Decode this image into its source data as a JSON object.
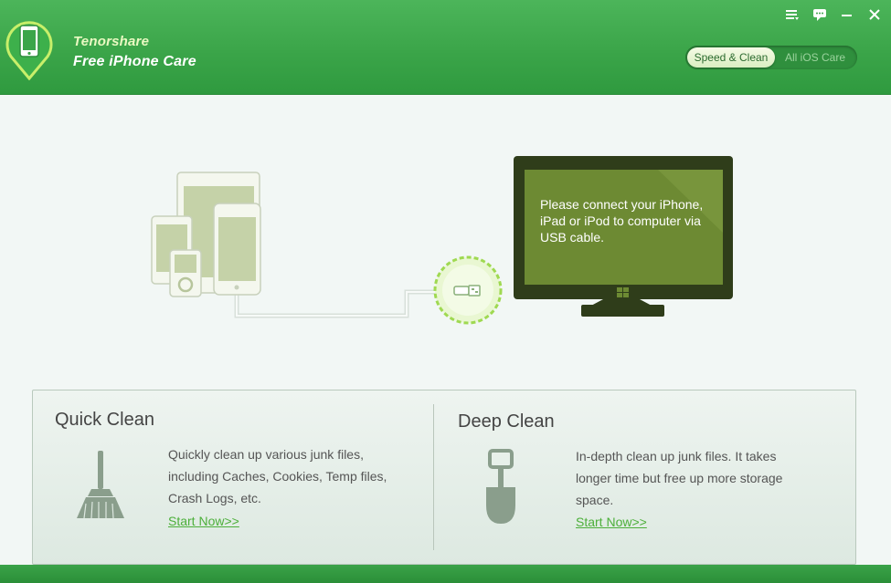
{
  "header": {
    "company": "Tenorshare",
    "product": "Free iPhone Care",
    "mode_tabs": [
      {
        "label": "Speed & Clean",
        "active": true
      },
      {
        "label": "All iOS Care",
        "active": false
      }
    ],
    "window_controls": [
      "menu-icon",
      "feedback-icon",
      "minimize-icon",
      "close-icon"
    ]
  },
  "illustration": {
    "message": "Please connect your iPhone, iPad or iPod to computer via USB cable."
  },
  "quick_clean": {
    "title": "Quick Clean",
    "icon": "broom-icon",
    "description": "Quickly clean up various junk files, including Caches, Cookies, Temp files, Crash Logs, etc.",
    "link": "Start Now>>"
  },
  "deep_clean": {
    "title": "Deep Clean",
    "icon": "shovel-icon",
    "description": "In-depth clean up junk files. It takes longer time but free up more storage space.",
    "link": "Start Now>>"
  },
  "colors": {
    "brand_green": "#3ba549",
    "link_green": "#4caf3a",
    "monitor_screen": "#6d8a33"
  }
}
